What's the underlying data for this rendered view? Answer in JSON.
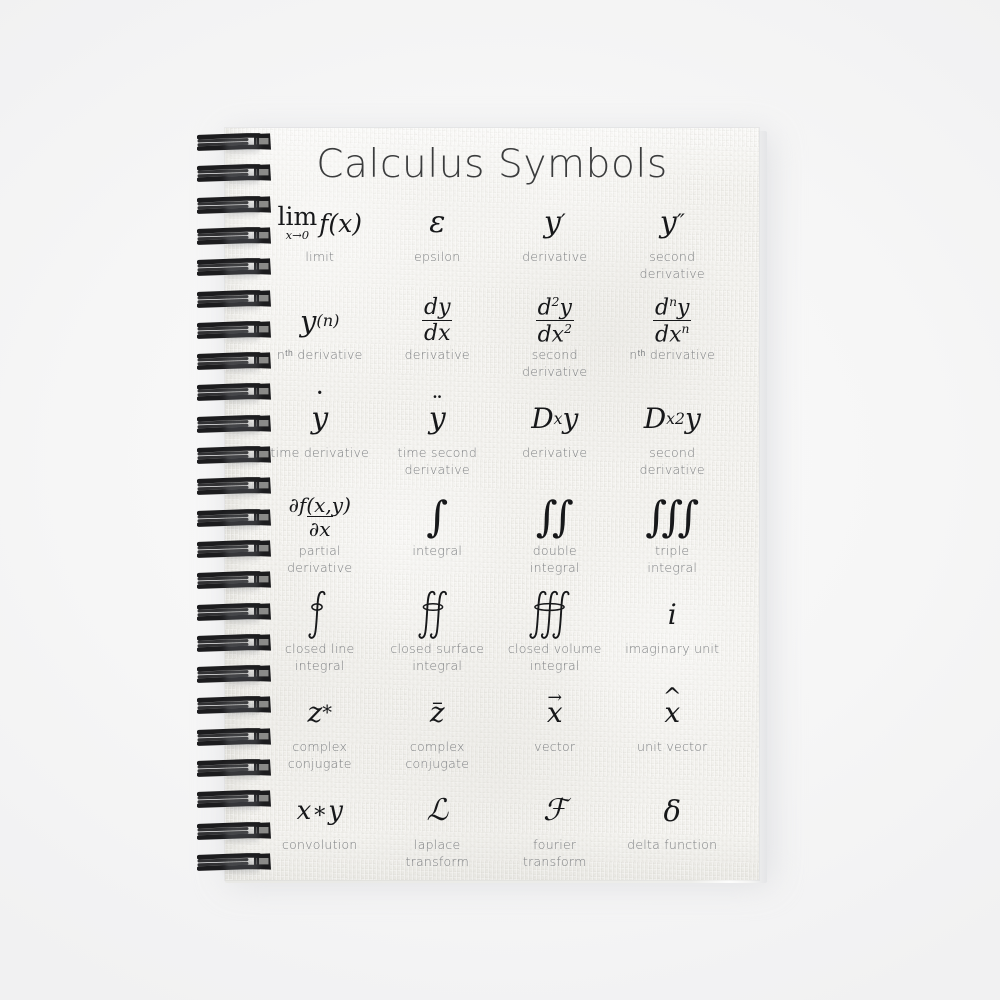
{
  "page": {
    "title": "Calculus Symbols",
    "background_color": "#f7f7f7",
    "paper_color": "#f3f2ee",
    "title_color": "#3b3c3d",
    "symbol_color": "#17181a",
    "label_color": "#7e8083",
    "coil_color": "#1c1c1e",
    "binding": {
      "type": "spiral-wire",
      "coil_count": 24,
      "side": "left"
    }
  },
  "grid": {
    "columns": 4,
    "rows": 7,
    "cells": [
      {
        "symbol": "lim f(x)",
        "label": "limit"
      },
      {
        "symbol": "ε",
        "label": "epsilon"
      },
      {
        "symbol": "y′",
        "label": "derivative"
      },
      {
        "symbol": "y″",
        "label": "second derivative"
      },
      {
        "symbol": "y^(n)",
        "label": "nᵗʰ derivative"
      },
      {
        "symbol": "dy/dx",
        "label": "derivative"
      },
      {
        "symbol": "d²y/dx²",
        "label": "second derivative"
      },
      {
        "symbol": "dⁿy/dxⁿ",
        "label": "nᵗʰ derivative"
      },
      {
        "symbol": "ẏ",
        "label": "time derivative"
      },
      {
        "symbol": "ÿ",
        "label": "time second derivative"
      },
      {
        "symbol": "Dₓy",
        "label": "derivative"
      },
      {
        "symbol": "Dₓ²y",
        "label": "second derivative"
      },
      {
        "symbol": "∂f(x,y)/∂x",
        "label": "partial derivative"
      },
      {
        "symbol": "∫",
        "label": "integral"
      },
      {
        "symbol": "∬",
        "label": "double integral"
      },
      {
        "symbol": "∭",
        "label": "triple integral"
      },
      {
        "symbol": "∮",
        "label": "closed line integral"
      },
      {
        "symbol": "∯",
        "label": "closed surface integral"
      },
      {
        "symbol": "∰",
        "label": "closed volume integral"
      },
      {
        "symbol": "i",
        "label": "imaginary unit"
      },
      {
        "symbol": "z*",
        "label": "complex conjugate"
      },
      {
        "symbol": "z̄",
        "label": "complex conjugate"
      },
      {
        "symbol": "x⃗",
        "label": "vector"
      },
      {
        "symbol": "x̂",
        "label": "unit vector"
      },
      {
        "symbol": "x∗y",
        "label": "convolution"
      },
      {
        "symbol": "ℒ",
        "label": "laplace transform"
      },
      {
        "symbol": "ℱ",
        "label": "fourier transform"
      },
      {
        "symbol": "δ",
        "label": "delta function"
      }
    ]
  },
  "labels": {
    "limit": "limit",
    "epsilon": "epsilon",
    "derivative": "derivative",
    "second_derivative_l1": "second",
    "second_derivative_l2": "derivative",
    "nth_derivative": "nᵗʰ derivative",
    "time_derivative": "time derivative",
    "time_second_l1": "time second",
    "time_second_l2": "derivative",
    "partial_l1": "partial",
    "partial_l2": "derivative",
    "integral": "integral",
    "double_l1": "double",
    "double_l2": "integral",
    "triple_l1": "triple",
    "triple_l2": "integral",
    "closed_line_l1": "closed line",
    "closed_line_l2": "integral",
    "closed_surface_l1": "closed surface",
    "closed_surface_l2": "integral",
    "closed_volume_l1": "closed volume",
    "closed_volume_l2": "integral",
    "imaginary_unit": "imaginary unit",
    "complex_l1": "complex",
    "complex_l2": "conjugate",
    "vector": "vector",
    "unit_vector": "unit vector",
    "convolution": "convolution",
    "laplace_l1": "laplace",
    "laplace_l2": "transform",
    "fourier_l1": "fourier",
    "fourier_l2": "transform",
    "delta_function": "delta function"
  },
  "glyphs": {
    "lim": "lim",
    "x_to_0": "x→0",
    "fx": "f(x)",
    "epsilon": "ε",
    "y": "y",
    "prime": "′",
    "dprime": "″",
    "paren_n": "(n)",
    "d": "d",
    "dx": "dx",
    "dy": "dy",
    "two": "2",
    "n": "n",
    "D": "D",
    "x": "x",
    "z": "z",
    "i": "i",
    "star": "*",
    "asterisk_conv": "∗",
    "partial": "∂",
    "partial_fxy": "∂f(x,y)",
    "partial_x": "∂x",
    "integral": "∫",
    "laplace": "ℒ",
    "fourier": "ℱ",
    "delta": "δ",
    "dot": "˙",
    "ddot": "¨",
    "bar": "–",
    "hat": "^",
    "vec_arrow": "→"
  }
}
